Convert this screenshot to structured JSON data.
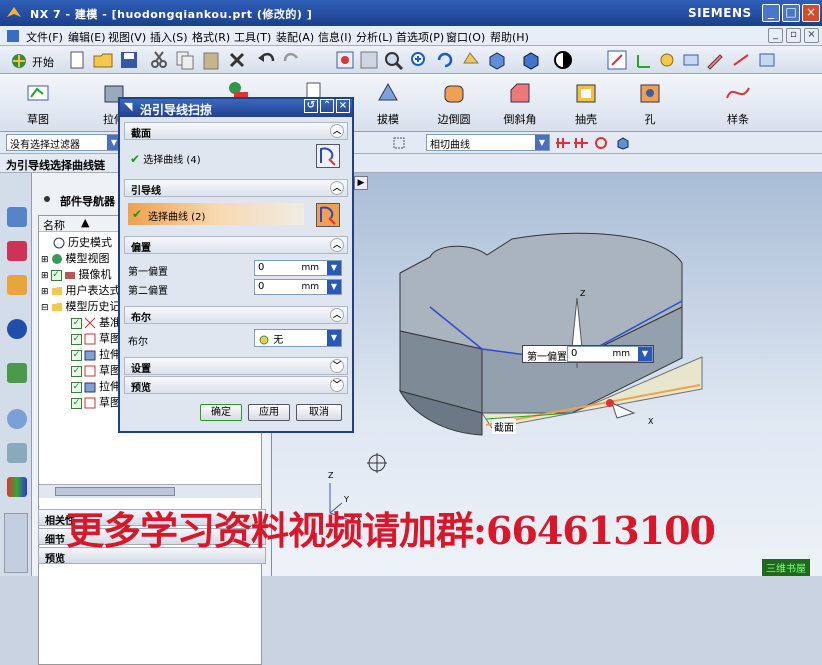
{
  "window": {
    "title": "NX 7 - 建模 - [huodongqiankou.prt  (修改的)  ]",
    "brand": "SIEMENS",
    "controls": [
      "_",
      "□",
      "×"
    ]
  },
  "menu": [
    "文件(F)",
    "编辑(E)",
    "视图(V)",
    "插入(S)",
    "格式(R)",
    "工具(T)",
    "装配(A)",
    "信息(I)",
    "分析(L)",
    "首选项(P)",
    "窗口(O)",
    "帮助(H)"
  ],
  "toolbar1": {
    "start_label": "开始"
  },
  "toolbar2": {
    "labels": [
      "草图",
      "拉伸",
      "拔模",
      "边倒圆",
      "倒斜角",
      "抽壳",
      "孔",
      "样条"
    ]
  },
  "filter": {
    "selection_filter": "没有选择过滤器",
    "curve_rule": "相切曲线"
  },
  "status": {
    "prompt": "为引导线选择曲线链"
  },
  "navigator": {
    "title": "部件导航器",
    "column_name": "名称",
    "items": [
      {
        "label": "历史模式"
      },
      {
        "label": "模型视图"
      },
      {
        "label": "摄像机"
      },
      {
        "label": "用户表达式"
      },
      {
        "label": "模型历史记"
      },
      {
        "label": "基准"
      },
      {
        "label": "草图"
      },
      {
        "label": "拉伸"
      },
      {
        "label": "草图"
      },
      {
        "label": "拉伸"
      },
      {
        "label": "草图"
      }
    ],
    "lower_sections": [
      "相关性",
      "细节",
      "预览"
    ]
  },
  "dialog": {
    "title": "沿引导线扫掠",
    "section_header": "截面",
    "section_select": "选择曲线 (4)",
    "guide_header": "引导线",
    "guide_select": "选择曲线 (2)",
    "offset_header": "偏置",
    "first_offset_label": "第一偏置",
    "first_offset_value": "0",
    "first_offset_unit": "mm",
    "second_offset_label": "第二偏置",
    "second_offset_value": "0",
    "second_offset_unit": "mm",
    "boolean_header": "布尔",
    "boolean_label": "布尔",
    "boolean_value": "无",
    "settings_header": "设置",
    "preview_header": "预览",
    "ok": "确定",
    "apply": "应用",
    "cancel": "取消"
  },
  "viewport": {
    "callout_label": "第一偏置",
    "callout_value": "0",
    "callout_unit": "mm",
    "section_tag": "截面",
    "axis_x": "X",
    "axis_y": "Y",
    "axis_z": "Z"
  },
  "watermark": "更多学习资料视频请加群:664613100",
  "corner_tag": "三维书屋",
  "colors": {
    "titlebar": "#1d3f8c",
    "accent_orange": "#f0a050",
    "model_top": "#aab4be",
    "model_side": "#7e8a96",
    "watermark": "#d8172a"
  }
}
